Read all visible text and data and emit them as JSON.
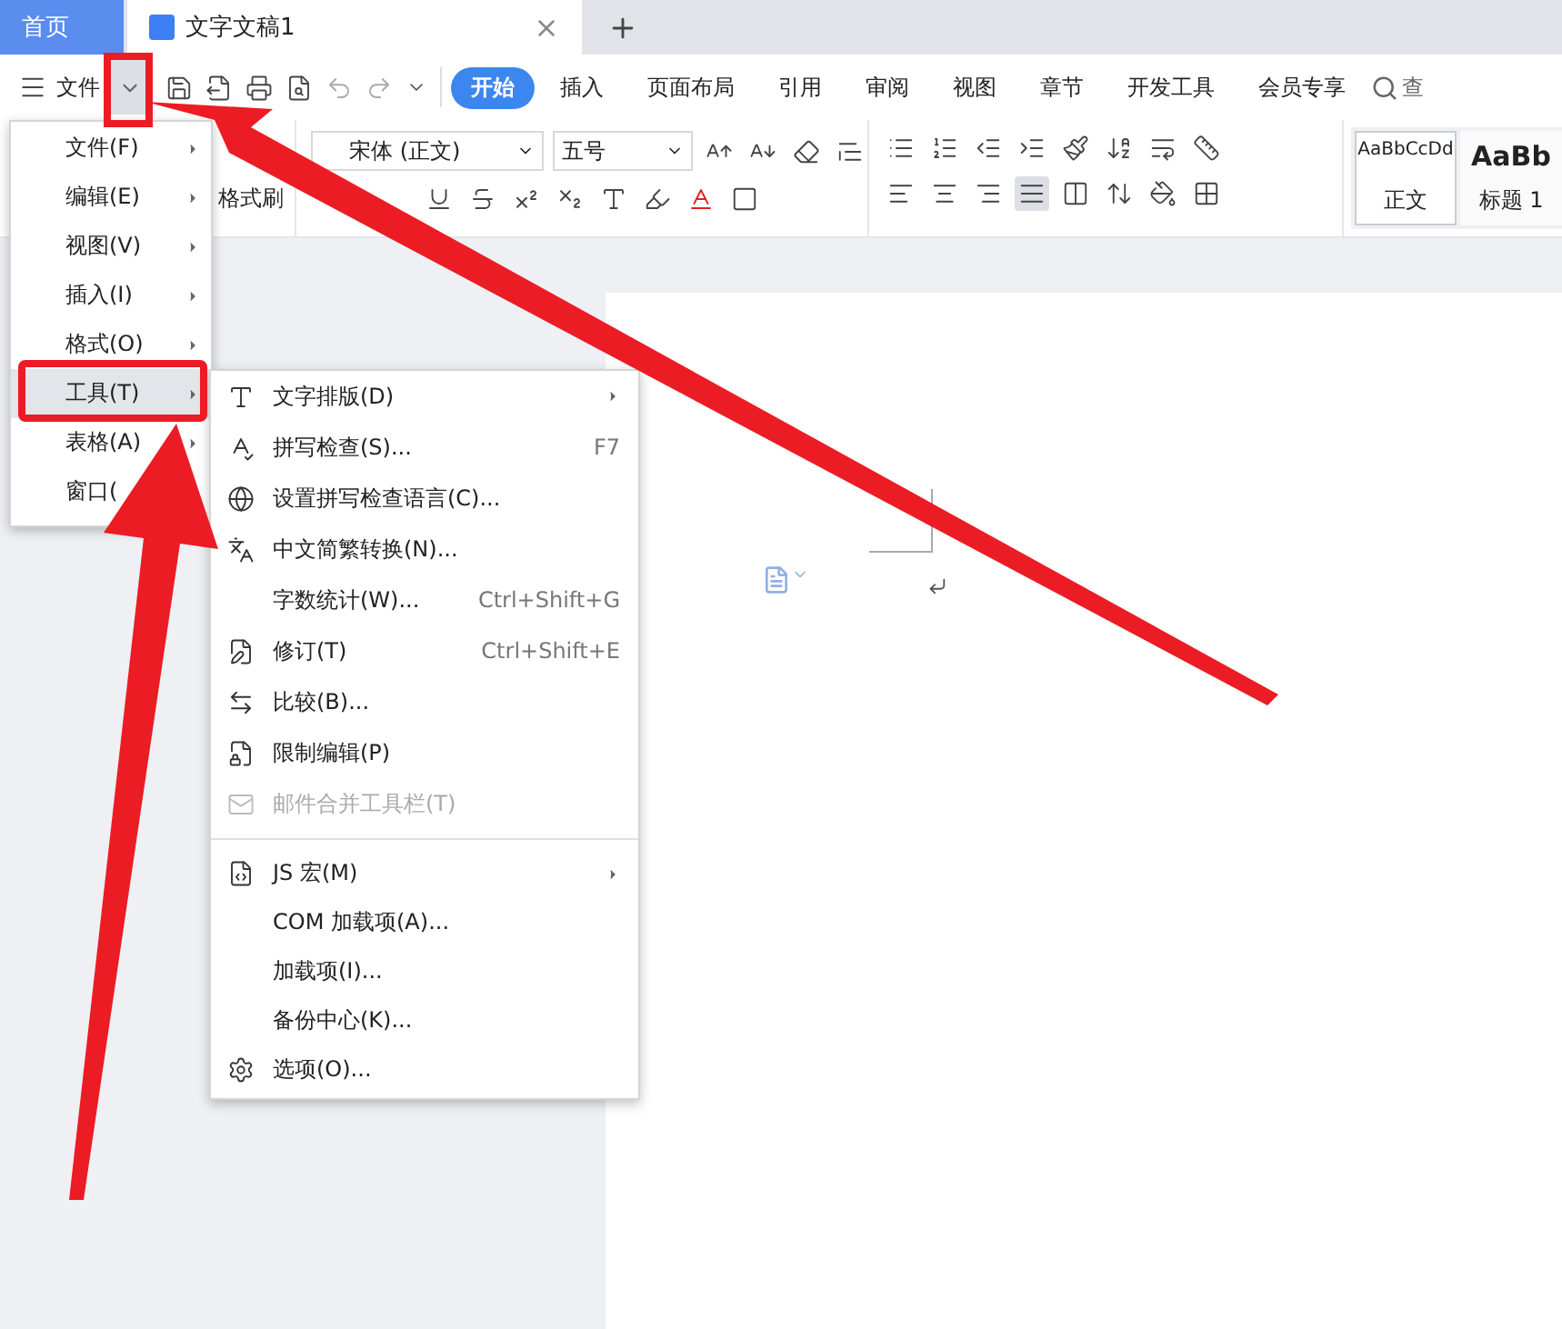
{
  "tabs": [
    {
      "label": "首页",
      "kind": "home",
      "selected": false
    },
    {
      "label": "文字文稿1",
      "kind": "document",
      "selected": true
    }
  ],
  "menu_button": {
    "label": "文件"
  },
  "ribbon_tabs": [
    {
      "label": "开始",
      "selected": true
    },
    {
      "label": "插入",
      "selected": false
    },
    {
      "label": "页面布局",
      "selected": false
    },
    {
      "label": "引用",
      "selected": false
    },
    {
      "label": "审阅",
      "selected": false
    },
    {
      "label": "视图",
      "selected": false
    },
    {
      "label": "章节",
      "selected": false
    },
    {
      "label": "开发工具",
      "selected": false
    },
    {
      "label": "会员专享",
      "selected": false
    }
  ],
  "search": {
    "label": "查"
  },
  "ribbon": {
    "format_painter": "格式刷",
    "font": "宋体 (正文)",
    "size": "五号",
    "alignments": [
      {
        "kind": "left",
        "selected": false
      },
      {
        "kind": "center",
        "selected": false
      },
      {
        "kind": "right",
        "selected": false
      },
      {
        "kind": "justify",
        "selected": true
      },
      {
        "kind": "distribute",
        "selected": false
      }
    ],
    "styles": [
      {
        "preview": "AaBbCcDd",
        "label": "正文",
        "selected": true
      },
      {
        "preview": "AaBb",
        "label": "标题 1",
        "selected": false
      }
    ]
  },
  "menu": {
    "items": [
      {
        "label": "文件(F)",
        "selected": false
      },
      {
        "label": "编辑(E)",
        "selected": false
      },
      {
        "label": "视图(V)",
        "selected": false
      },
      {
        "label": "插入(I)",
        "selected": false
      },
      {
        "label": "格式(O)",
        "selected": false
      },
      {
        "label": "工具(T)",
        "selected": true
      },
      {
        "label": "表格(A)",
        "selected": false
      },
      {
        "label": "窗口(",
        "selected": false
      }
    ]
  },
  "submenu": {
    "groups": [
      [
        {
          "label": "文字排版(D)",
          "kind": "layout",
          "submenu": true,
          "disabled": false
        },
        {
          "label": "拼写检查(S)...",
          "kind": "spell",
          "shortcut": "F7",
          "submenu": false,
          "disabled": false
        },
        {
          "label": "设置拼写检查语言(C)...",
          "kind": "language",
          "submenu": false,
          "disabled": false
        },
        {
          "label": "中文简繁转换(N)...",
          "kind": "convert",
          "submenu": false,
          "disabled": false
        },
        {
          "label": "字数统计(W)...",
          "kind": "plain",
          "shortcut": "Ctrl+Shift+G",
          "submenu": false,
          "disabled": false
        },
        {
          "label": "修订(T)",
          "kind": "revise",
          "shortcut": "Ctrl+Shift+E",
          "submenu": false,
          "disabled": false
        },
        {
          "label": "比较(B)...",
          "kind": "compare",
          "submenu": false,
          "disabled": false
        },
        {
          "label": "限制编辑(P)",
          "kind": "lock",
          "submenu": false,
          "disabled": false
        },
        {
          "label": "邮件合并工具栏(T)",
          "kind": "mail",
          "submenu": false,
          "disabled": true
        }
      ],
      [
        {
          "label": "JS 宏(M)",
          "kind": "script",
          "submenu": true,
          "disabled": false
        },
        {
          "label": "COM 加载项(A)...",
          "kind": "plain",
          "submenu": false,
          "disabled": false
        },
        {
          "label": "加载项(I)...",
          "kind": "plain",
          "submenu": false,
          "disabled": false
        },
        {
          "label": "备份中心(K)...",
          "kind": "plain",
          "submenu": false,
          "disabled": false
        },
        {
          "label": "选项(O)...",
          "kind": "settings",
          "submenu": false,
          "disabled": false
        }
      ]
    ]
  }
}
